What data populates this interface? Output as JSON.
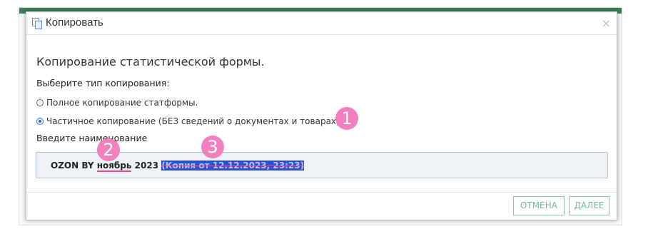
{
  "dialog": {
    "title": "Копировать",
    "close_glyph": "×",
    "heading": "Копирование статистической формы.",
    "type_label": "Выберите тип копирования:",
    "options": [
      {
        "label": "Полное копирование статформы.",
        "checked": false
      },
      {
        "label": "Частичное копирование (БЕЗ сведений о документах и товарах)",
        "checked": true
      }
    ],
    "name_label": "Введите наименование",
    "name_value": {
      "part1": "OZON BY ",
      "part2": "ноябрь",
      "part3": " 2023 ",
      "part4": "(Копия от 12.12.2023, 23:23)"
    },
    "buttons": {
      "cancel": "ОТМЕНА",
      "next": "ДАЛЕЕ"
    }
  },
  "annotations": [
    "1",
    "2",
    "3"
  ],
  "colors": {
    "accent_green": "#78b996",
    "badge_pink": "#f080be",
    "selection_blue": "#2e4fcf",
    "radio_blue": "#2a6fd6"
  },
  "icons": {
    "title": "copy-icon",
    "close": "close-icon"
  }
}
